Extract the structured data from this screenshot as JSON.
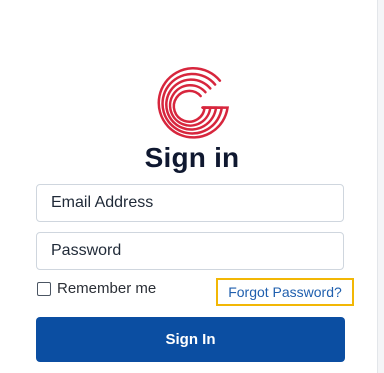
{
  "brand": {
    "logo_icon": "g-logo-icon",
    "logo_color": "#d7263d"
  },
  "page": {
    "title": "Sign in"
  },
  "form": {
    "email_placeholder": "Email Address",
    "password_placeholder": "Password",
    "remember_label": "Remember me",
    "forgot_label": "Forgot Password?",
    "submit_label": "Sign In"
  },
  "colors": {
    "primary": "#0b4ea2",
    "highlight": "#f2b705",
    "link": "#1f5fae"
  }
}
